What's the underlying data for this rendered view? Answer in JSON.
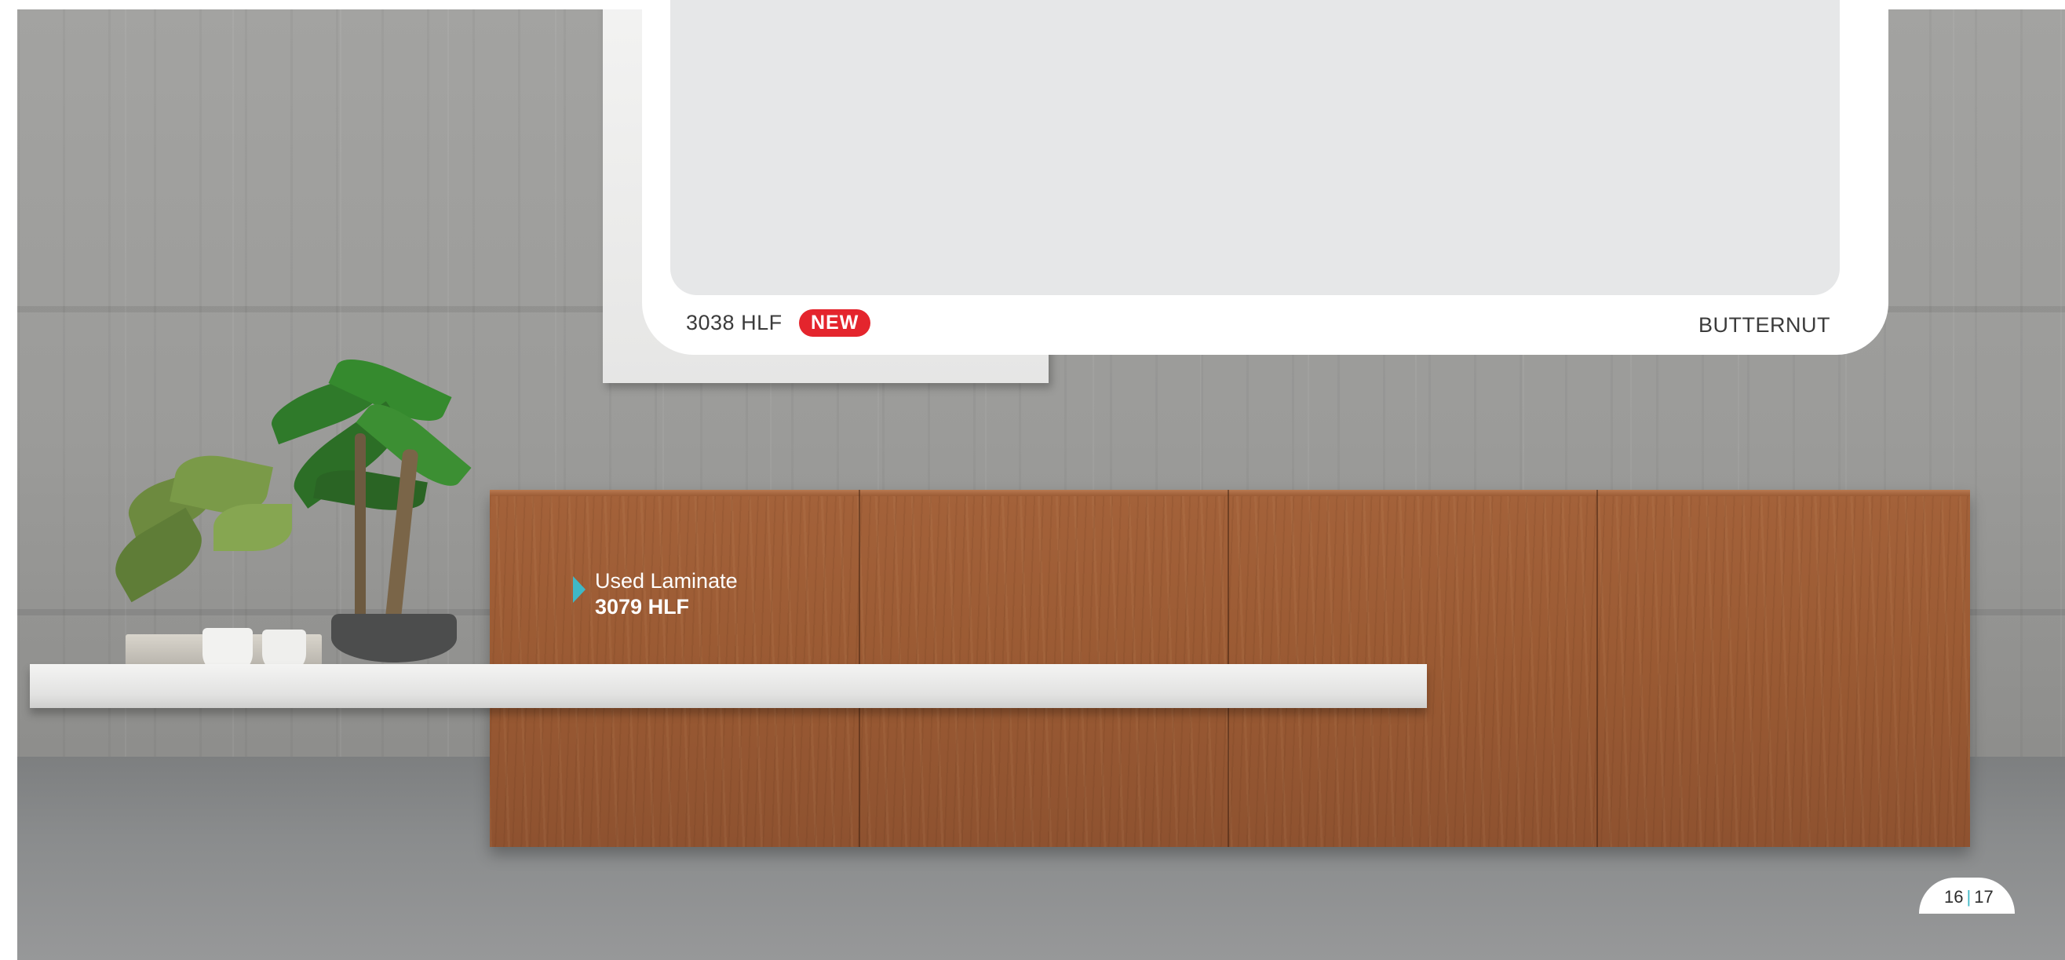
{
  "swatch_card": {
    "code": "3038 HLF",
    "badge": "NEW",
    "name": "BUTTERNUT",
    "badge_color": "#e4252d"
  },
  "used_laminate": {
    "title": "Used Laminate",
    "code": "3079 HLF",
    "marker_color": "#3fb8c6"
  },
  "page_indicator": {
    "left": "16",
    "separator": "|",
    "right": "17"
  },
  "photo": {
    "icons": [
      "plant-icon"
    ]
  }
}
